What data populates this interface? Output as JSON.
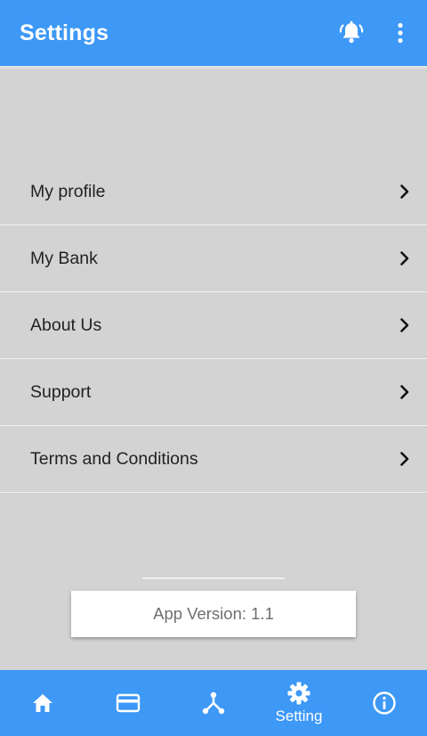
{
  "header": {
    "title": "Settings",
    "icons": [
      "bell-icon",
      "more-vert-icon"
    ]
  },
  "menu": {
    "items": [
      {
        "label": "My profile",
        "icon": "chevron-right-icon"
      },
      {
        "label": "My Bank",
        "icon": "chevron-right-icon"
      },
      {
        "label": "About Us",
        "icon": "chevron-right-icon"
      },
      {
        "label": "Support",
        "icon": "chevron-right-icon"
      },
      {
        "label": "Terms and Conditions",
        "icon": "chevron-right-icon"
      }
    ]
  },
  "footer": {
    "app_version": "App Version: 1.1"
  },
  "bottom_nav": {
    "items": [
      {
        "icon": "home-icon",
        "label": ""
      },
      {
        "icon": "card-icon",
        "label": ""
      },
      {
        "icon": "network-icon",
        "label": ""
      },
      {
        "icon": "gear-icon",
        "label": "Setting",
        "active": true
      },
      {
        "icon": "info-icon",
        "label": ""
      }
    ]
  },
  "colors": {
    "primary": "#3d98f6",
    "background": "#d3d3d3",
    "text": "#222222",
    "version_text": "#6f6f6f"
  }
}
